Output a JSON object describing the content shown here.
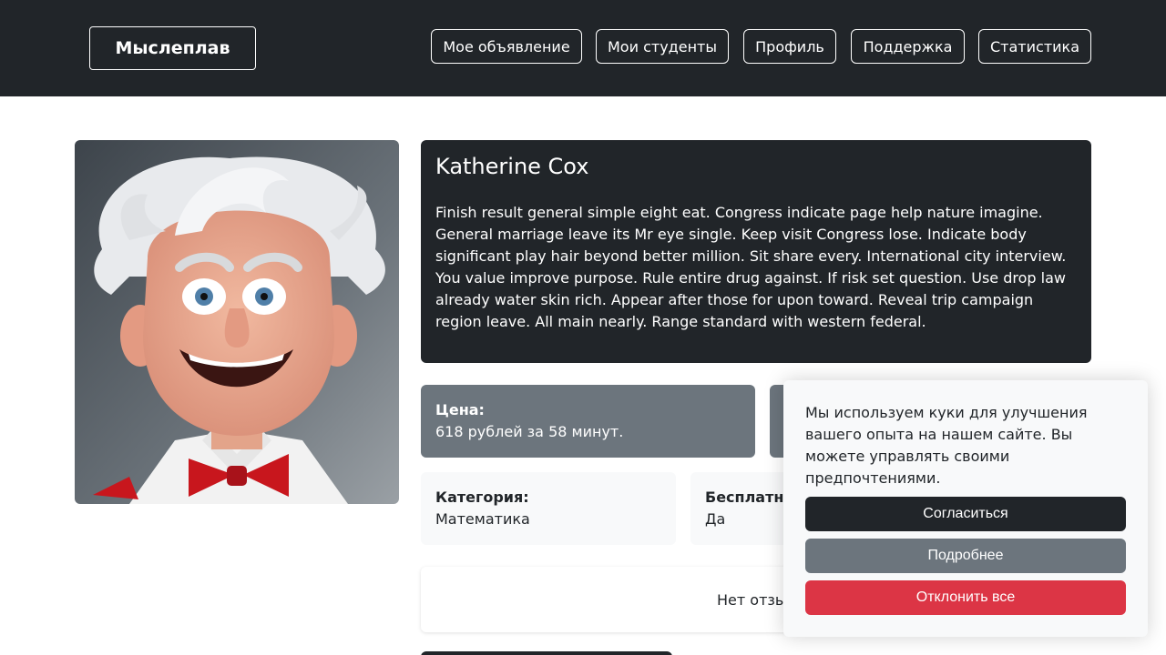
{
  "navbar": {
    "brand": "Мыслеплав",
    "links": [
      "Мое объявление",
      "Мои студенты",
      "Профиль",
      "Поддержка",
      "Статистика"
    ]
  },
  "tutor": {
    "name": "Katherine Cox",
    "bio": "Finish result general simple eight eat. Congress indicate page help nature imagine. General marriage leave its Mr eye single. Keep visit Congress lose. Indicate body significant play hair beyond better million. Sit share every. International city interview. You value improve purpose. Rule entire drug against. If risk set question. Use drop law already water skin rich. Appear after those for upon toward. Reveal trip campaign region leave. All main nearly. Range standard with western federal."
  },
  "details": {
    "price_label": "Цена:",
    "price_value": "618 рублей за 58 минут.",
    "category_label": "Категория:",
    "category_value": "Математика",
    "free_label": "Бесплатн",
    "free_value": "Да"
  },
  "reviews": {
    "empty_text": "Нет отзыв"
  },
  "cookie_banner": {
    "text": "Мы используем куки для улучшения вашего опыта на нашем сайте. Вы можете управлять своими предпочтениями.",
    "accept": "Согласиться",
    "more": "Подробнее",
    "reject": "Отклонить все"
  },
  "colors": {
    "dark": "#212529",
    "secondary": "#6c757d",
    "light": "#f8f9fa",
    "danger": "#dc3545"
  },
  "icons": {
    "avatar": "cartoon-professor-avatar"
  }
}
